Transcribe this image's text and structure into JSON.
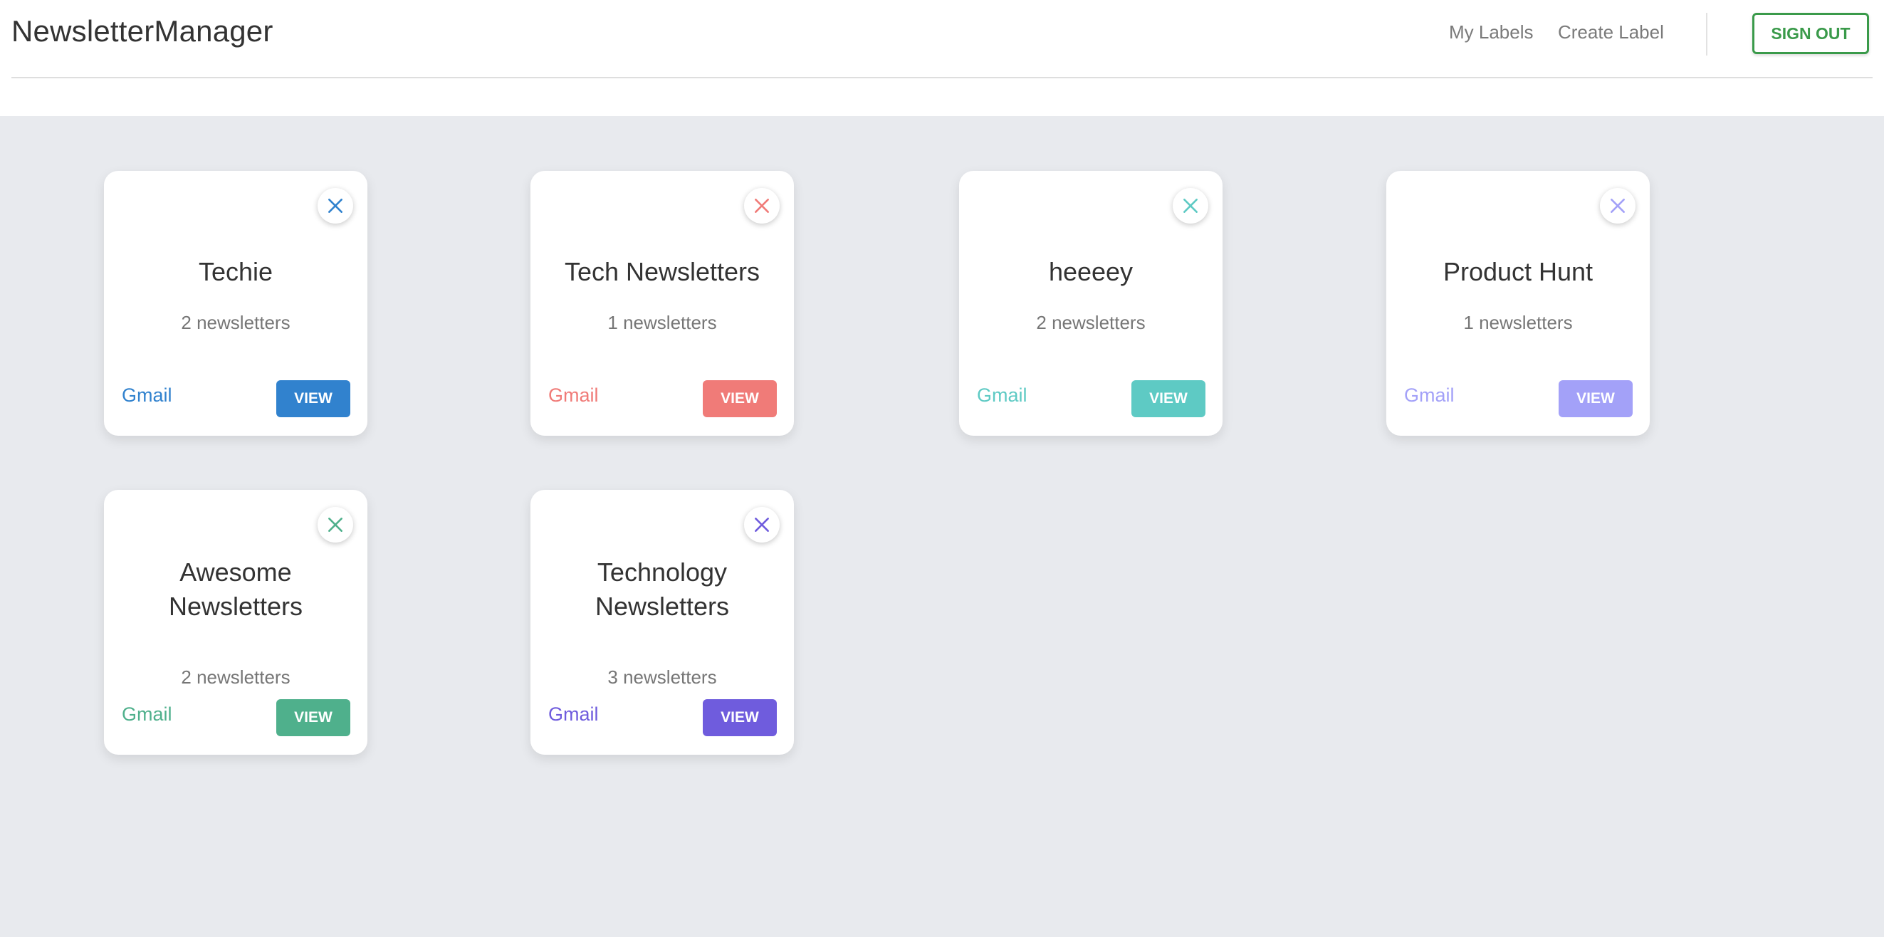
{
  "header": {
    "brand": "NewsletterManager",
    "nav": {
      "my_labels": "My Labels",
      "create_label": "Create Label"
    },
    "sign_out": "SIGN OUT",
    "sign_out_color": "#3a9a4a"
  },
  "labels": [
    {
      "title": "Techie",
      "count": "2 newsletters",
      "provider": "Gmail",
      "view": "VIEW",
      "color": "#3182ce",
      "close_icon": "close-icon"
    },
    {
      "title": "Tech Newsletters",
      "count": "1 newsletters",
      "provider": "Gmail",
      "view": "VIEW",
      "color": "#f07b78",
      "close_icon": "close-icon"
    },
    {
      "title": "heeeey",
      "count": "2 newsletters",
      "provider": "Gmail",
      "view": "VIEW",
      "color": "#5ecac4",
      "close_icon": "close-icon"
    },
    {
      "title": "Product Hunt",
      "count": "1 newsletters",
      "provider": "Gmail",
      "view": "VIEW",
      "color": "#a3a1f8",
      "close_icon": "close-icon"
    },
    {
      "title": "Awesome Newsletters",
      "count": "2 newsletters",
      "provider": "Gmail",
      "view": "VIEW",
      "color": "#4fb08c",
      "close_icon": "close-icon"
    },
    {
      "title": "Technology Newsletters",
      "count": "3 newsletters",
      "provider": "Gmail",
      "view": "VIEW",
      "color": "#6f5cdd",
      "close_icon": "close-icon"
    }
  ]
}
